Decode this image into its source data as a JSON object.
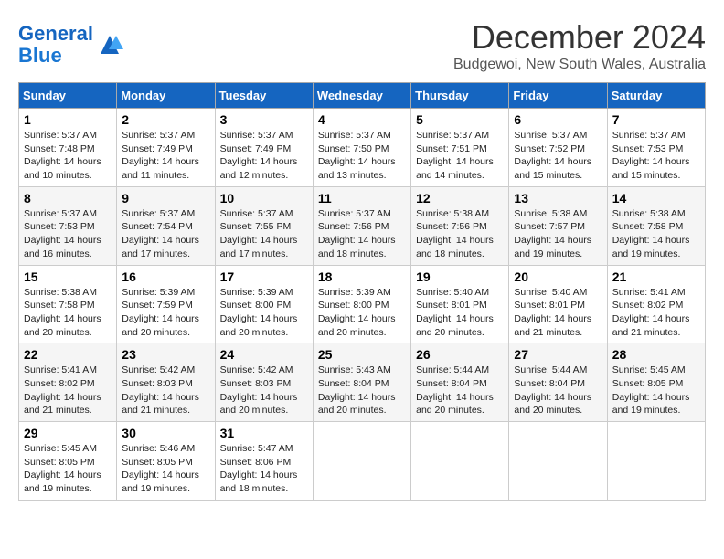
{
  "logo": {
    "line1": "General",
    "line2": "Blue"
  },
  "title": "December 2024",
  "subtitle": "Budgewoi, New South Wales, Australia",
  "weekdays": [
    "Sunday",
    "Monday",
    "Tuesday",
    "Wednesday",
    "Thursday",
    "Friday",
    "Saturday"
  ],
  "weeks": [
    [
      {
        "day": 1,
        "sunrise": "5:37 AM",
        "sunset": "7:48 PM",
        "daylight": "14 hours and 10 minutes."
      },
      {
        "day": 2,
        "sunrise": "5:37 AM",
        "sunset": "7:49 PM",
        "daylight": "14 hours and 11 minutes."
      },
      {
        "day": 3,
        "sunrise": "5:37 AM",
        "sunset": "7:49 PM",
        "daylight": "14 hours and 12 minutes."
      },
      {
        "day": 4,
        "sunrise": "5:37 AM",
        "sunset": "7:50 PM",
        "daylight": "14 hours and 13 minutes."
      },
      {
        "day": 5,
        "sunrise": "5:37 AM",
        "sunset": "7:51 PM",
        "daylight": "14 hours and 14 minutes."
      },
      {
        "day": 6,
        "sunrise": "5:37 AM",
        "sunset": "7:52 PM",
        "daylight": "14 hours and 15 minutes."
      },
      {
        "day": 7,
        "sunrise": "5:37 AM",
        "sunset": "7:53 PM",
        "daylight": "14 hours and 15 minutes."
      }
    ],
    [
      {
        "day": 8,
        "sunrise": "5:37 AM",
        "sunset": "7:53 PM",
        "daylight": "14 hours and 16 minutes."
      },
      {
        "day": 9,
        "sunrise": "5:37 AM",
        "sunset": "7:54 PM",
        "daylight": "14 hours and 17 minutes."
      },
      {
        "day": 10,
        "sunrise": "5:37 AM",
        "sunset": "7:55 PM",
        "daylight": "14 hours and 17 minutes."
      },
      {
        "day": 11,
        "sunrise": "5:37 AM",
        "sunset": "7:56 PM",
        "daylight": "14 hours and 18 minutes."
      },
      {
        "day": 12,
        "sunrise": "5:38 AM",
        "sunset": "7:56 PM",
        "daylight": "14 hours and 18 minutes."
      },
      {
        "day": 13,
        "sunrise": "5:38 AM",
        "sunset": "7:57 PM",
        "daylight": "14 hours and 19 minutes."
      },
      {
        "day": 14,
        "sunrise": "5:38 AM",
        "sunset": "7:58 PM",
        "daylight": "14 hours and 19 minutes."
      }
    ],
    [
      {
        "day": 15,
        "sunrise": "5:38 AM",
        "sunset": "7:58 PM",
        "daylight": "14 hours and 20 minutes."
      },
      {
        "day": 16,
        "sunrise": "5:39 AM",
        "sunset": "7:59 PM",
        "daylight": "14 hours and 20 minutes."
      },
      {
        "day": 17,
        "sunrise": "5:39 AM",
        "sunset": "8:00 PM",
        "daylight": "14 hours and 20 minutes."
      },
      {
        "day": 18,
        "sunrise": "5:39 AM",
        "sunset": "8:00 PM",
        "daylight": "14 hours and 20 minutes."
      },
      {
        "day": 19,
        "sunrise": "5:40 AM",
        "sunset": "8:01 PM",
        "daylight": "14 hours and 20 minutes."
      },
      {
        "day": 20,
        "sunrise": "5:40 AM",
        "sunset": "8:01 PM",
        "daylight": "14 hours and 21 minutes."
      },
      {
        "day": 21,
        "sunrise": "5:41 AM",
        "sunset": "8:02 PM",
        "daylight": "14 hours and 21 minutes."
      }
    ],
    [
      {
        "day": 22,
        "sunrise": "5:41 AM",
        "sunset": "8:02 PM",
        "daylight": "14 hours and 21 minutes."
      },
      {
        "day": 23,
        "sunrise": "5:42 AM",
        "sunset": "8:03 PM",
        "daylight": "14 hours and 21 minutes."
      },
      {
        "day": 24,
        "sunrise": "5:42 AM",
        "sunset": "8:03 PM",
        "daylight": "14 hours and 20 minutes."
      },
      {
        "day": 25,
        "sunrise": "5:43 AM",
        "sunset": "8:04 PM",
        "daylight": "14 hours and 20 minutes."
      },
      {
        "day": 26,
        "sunrise": "5:44 AM",
        "sunset": "8:04 PM",
        "daylight": "14 hours and 20 minutes."
      },
      {
        "day": 27,
        "sunrise": "5:44 AM",
        "sunset": "8:04 PM",
        "daylight": "14 hours and 20 minutes."
      },
      {
        "day": 28,
        "sunrise": "5:45 AM",
        "sunset": "8:05 PM",
        "daylight": "14 hours and 19 minutes."
      }
    ],
    [
      {
        "day": 29,
        "sunrise": "5:45 AM",
        "sunset": "8:05 PM",
        "daylight": "14 hours and 19 minutes."
      },
      {
        "day": 30,
        "sunrise": "5:46 AM",
        "sunset": "8:05 PM",
        "daylight": "14 hours and 19 minutes."
      },
      {
        "day": 31,
        "sunrise": "5:47 AM",
        "sunset": "8:06 PM",
        "daylight": "14 hours and 18 minutes."
      },
      null,
      null,
      null,
      null
    ]
  ],
  "labels": {
    "sunrise": "Sunrise:",
    "sunset": "Sunset:",
    "daylight": "Daylight:"
  },
  "colors": {
    "header_bg": "#1565c0",
    "header_text": "#ffffff"
  }
}
